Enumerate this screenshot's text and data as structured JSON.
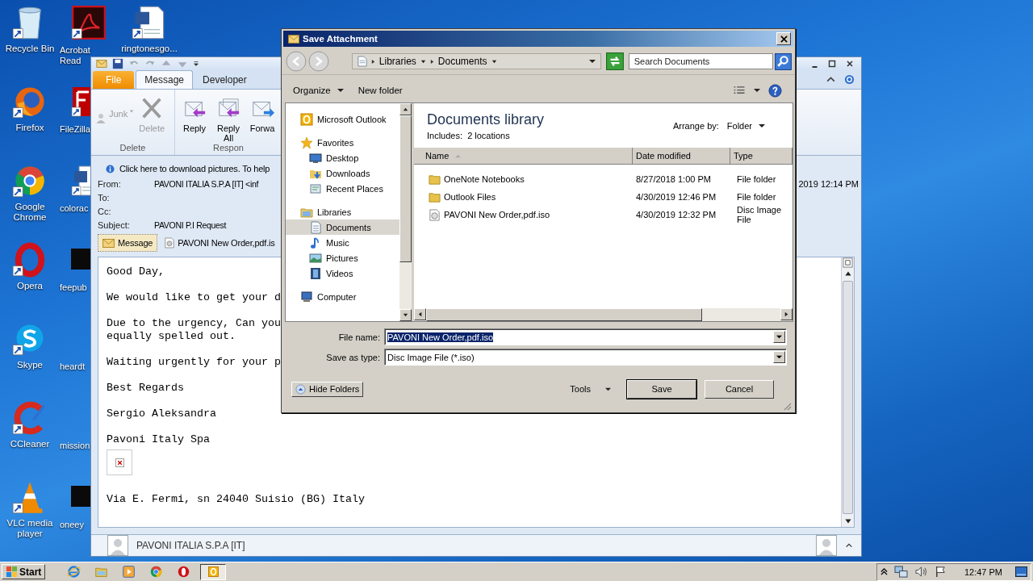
{
  "desktop": {
    "columns": [
      [
        {
          "label": "Recycle Bin",
          "kind": "recycle"
        },
        {
          "label": "Firefox",
          "kind": "firefox"
        },
        {
          "label": "Google Chrome",
          "kind": "chrome"
        },
        {
          "label": "Opera",
          "kind": "opera"
        },
        {
          "label": "Skype",
          "kind": "skype"
        },
        {
          "label": "CCleaner",
          "kind": "ccleaner"
        },
        {
          "label": "VLC media player",
          "kind": "vlc"
        }
      ],
      [
        {
          "label": "Acrobat Read",
          "kind": "acrobat"
        },
        {
          "label": "FileZilla",
          "kind": "filezilla"
        },
        {
          "label": "colorac",
          "kind": "word"
        },
        {
          "label": "feepub",
          "kind": "black"
        },
        {
          "label": "heardt",
          "kind": "blank"
        },
        {
          "label": "mission",
          "kind": "blank"
        },
        {
          "label": "oneey",
          "kind": "black"
        }
      ],
      [
        {
          "label": "ringtonesgo...",
          "kind": "word"
        }
      ]
    ]
  },
  "outlook": {
    "ribbon_tabs": [
      {
        "label": "File",
        "kind": "backstage",
        "selected": false
      },
      {
        "label": "Message",
        "kind": "tab",
        "selected": true
      },
      {
        "label": "Developer",
        "kind": "tab",
        "selected": false
      }
    ],
    "ribbon_groups": [
      {
        "label": "Delete",
        "buttons": [
          {
            "label": "Junk",
            "kind": "junk",
            "disabled": true
          },
          {
            "label": "Delete",
            "kind": "delete",
            "disabled": true
          }
        ]
      },
      {
        "label": "Respon",
        "buttons": [
          {
            "label": "Reply",
            "kind": "reply",
            "disabled": false
          },
          {
            "label": "Reply All",
            "kind": "reply_all",
            "disabled": false
          },
          {
            "label": "Forwa",
            "kind": "forward",
            "disabled": false
          }
        ]
      }
    ],
    "info_bar": "Click here to download pictures. To help",
    "fields": [
      {
        "label": "From:",
        "value": "PAVONI ITALIA S.P.A [IT] <inf"
      },
      {
        "label": "To:"
      },
      {
        "label": "Cc:"
      },
      {
        "label": "Subject:",
        "value": "PAVONI P.I Request"
      }
    ],
    "sent": "2019 12:14 PM",
    "attachments": [
      {
        "label": "Message",
        "kind": "message",
        "selected": true
      },
      {
        "label": "PAVONI New Order,pdf.is",
        "kind": "file",
        "selected": false
      }
    ],
    "body": [
      {
        "kind": "text",
        "lines": [
          "Good Day,"
        ]
      },
      {
        "kind": "text",
        "lines": [
          "We would like to get your d"
        ]
      },
      {
        "kind": "text",
        "lines": [
          "Due to the urgency, Can you",
          "equally spelled out."
        ]
      },
      {
        "kind": "text",
        "lines": [
          "Waiting urgently for your p"
        ]
      },
      {
        "kind": "text",
        "lines": [
          "Best Regards"
        ]
      },
      {
        "kind": "text",
        "lines": [
          "Sergio Aleksandra"
        ]
      },
      {
        "kind": "text",
        "lines": [
          "Pavoni Italy Spa"
        ]
      },
      {
        "kind": "broken_image"
      },
      {
        "kind": "text",
        "lines": [
          "Via E. Fermi, sn 24040 Suisio (BG) Italy"
        ]
      }
    ],
    "contact": "PAVONI ITALIA S.P.A [IT]"
  },
  "dialog": {
    "title": "Save Attachment",
    "breadcrumb": [
      "Libraries",
      "Documents"
    ],
    "search": {
      "placeholder": "Search Documents"
    },
    "toolbar": [
      {
        "label": "Organize",
        "kind": "menu"
      },
      {
        "label": "New folder",
        "kind": "button"
      }
    ],
    "nav": [
      {
        "label": "Microsoft Outlook",
        "kind": "outlook",
        "selected": false
      },
      {
        "label": "Favorites",
        "kind": "star",
        "selected": false,
        "children": [
          {
            "label": "Desktop",
            "kind": "desktop",
            "selected": false
          },
          {
            "label": "Downloads",
            "kind": "downloads",
            "selected": false
          },
          {
            "label": "Recent Places",
            "kind": "recent",
            "selected": false
          }
        ]
      },
      {
        "label": "Libraries",
        "kind": "library",
        "selected": false,
        "children": [
          {
            "label": "Documents",
            "kind": "documents",
            "selected": true
          },
          {
            "label": "Music",
            "kind": "music",
            "selected": false
          },
          {
            "label": "Pictures",
            "kind": "pictures",
            "selected": false
          },
          {
            "label": "Videos",
            "kind": "videos",
            "selected": false
          }
        ]
      },
      {
        "label": "Computer",
        "kind": "computer",
        "selected": false
      }
    ],
    "library": {
      "title": "Documents library",
      "includes": "Includes:  2 locations",
      "arrange_label": "Arrange by:",
      "arrange_value": "Folder"
    },
    "columns": [
      {
        "label": "Name",
        "sorted": true
      },
      {
        "label": "Date modified",
        "sorted": false
      },
      {
        "label": "Type",
        "sorted": false
      }
    ],
    "files": [
      {
        "name": "OneNote Notebooks",
        "date": "8/27/2018 1:00 PM",
        "type": "File folder",
        "kind": "folder"
      },
      {
        "name": "Outlook Files",
        "date": "4/30/2019 12:46 PM",
        "type": "File folder",
        "kind": "folder"
      },
      {
        "name": "PAVONI New Order,pdf.iso",
        "date": "4/30/2019 12:32 PM",
        "type": "Disc Image File",
        "kind": "disc"
      }
    ],
    "file_name": {
      "label": "File name:",
      "value": "PAVONI New Order,pdf.iso",
      "text_selected": true
    },
    "save_type": {
      "label": "Save as type:",
      "value": "Disc Image File (*.iso)"
    },
    "hide_folders": "Hide Folders",
    "tools": "Tools",
    "buttons": [
      {
        "label": "Save",
        "default": true
      },
      {
        "label": "Cancel",
        "default": false
      }
    ]
  },
  "taskbar": {
    "start": "Start",
    "apps": [
      {
        "kind": "ie",
        "selected": false
      },
      {
        "kind": "explorer",
        "selected": false
      },
      {
        "kind": "media",
        "selected": false
      },
      {
        "kind": "chrome",
        "selected": false
      },
      {
        "kind": "opera",
        "selected": false
      },
      {
        "kind": "outlook",
        "selected": true
      }
    ],
    "clock": "12:47 PM"
  }
}
